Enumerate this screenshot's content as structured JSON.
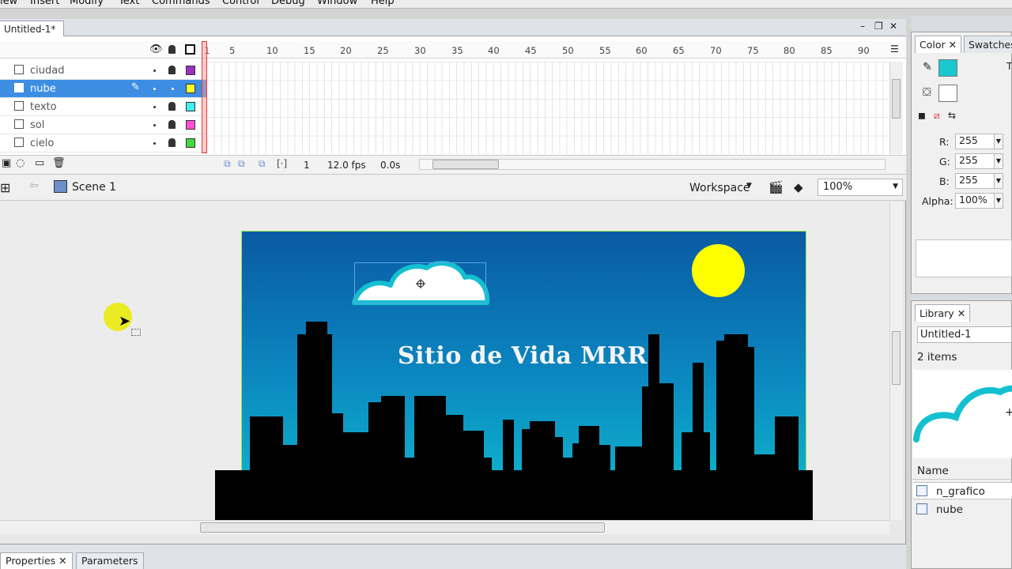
{
  "menu": [
    "iew",
    "Insert",
    "Modify",
    "Text",
    "Commands",
    "Control",
    "Debug",
    "Window",
    "Help"
  ],
  "document": {
    "tab_title": "Untitled-1*",
    "minimize": "–",
    "restore": "❐",
    "close": "✕"
  },
  "timeline": {
    "frame_numbers": [
      "1",
      "5",
      "10",
      "15",
      "20",
      "25",
      "30",
      "35",
      "40",
      "45",
      "50",
      "55",
      "60",
      "65",
      "70",
      "75",
      "80",
      "85",
      "90"
    ],
    "layers": [
      {
        "name": "ciudad",
        "color": "#9b2fc2",
        "selected": false
      },
      {
        "name": "nube",
        "color": "#ffff30",
        "selected": true
      },
      {
        "name": "texto",
        "color": "#3ff0f0",
        "selected": false
      },
      {
        "name": "sol",
        "color": "#ff4fd8",
        "selected": false
      },
      {
        "name": "cielo",
        "color": "#3fd93f",
        "selected": false
      }
    ],
    "current_frame": "1",
    "fps": "12.0 fps",
    "time": "0.0s"
  },
  "editbar": {
    "scene": "Scene 1",
    "workspace": "Workspace",
    "zoom": "100%"
  },
  "stage": {
    "title_text": "Sitio de Vida MRR",
    "sky_top_color": "#0a5aa4",
    "sky_bottom_color": "#10c0d0",
    "sun_color": "#ffff00",
    "cloud_stroke_color": "#14c0d0",
    "cloud_fill_color": "#ffffff",
    "city_color": "#000000"
  },
  "bottom_tabs": {
    "properties": "Properties",
    "parameters": "Parameters"
  },
  "color_panel": {
    "tabs": {
      "color": "Color",
      "swatches": "Swatches"
    },
    "r_label": "R:",
    "r_value": "255",
    "g_label": "G:",
    "g_value": "255",
    "b_label": "B:",
    "b_value": "255",
    "alpha_label": "Alpha:",
    "alpha_value": "100%",
    "stroke_color": "#1ac8d0",
    "t_label": "T"
  },
  "library": {
    "tab": "Library",
    "document": "Untitled-1",
    "count": "2 items",
    "name_header": "Name",
    "items": [
      {
        "name": "n_grafico",
        "selected": true
      },
      {
        "name": "nube",
        "selected": false
      }
    ]
  }
}
